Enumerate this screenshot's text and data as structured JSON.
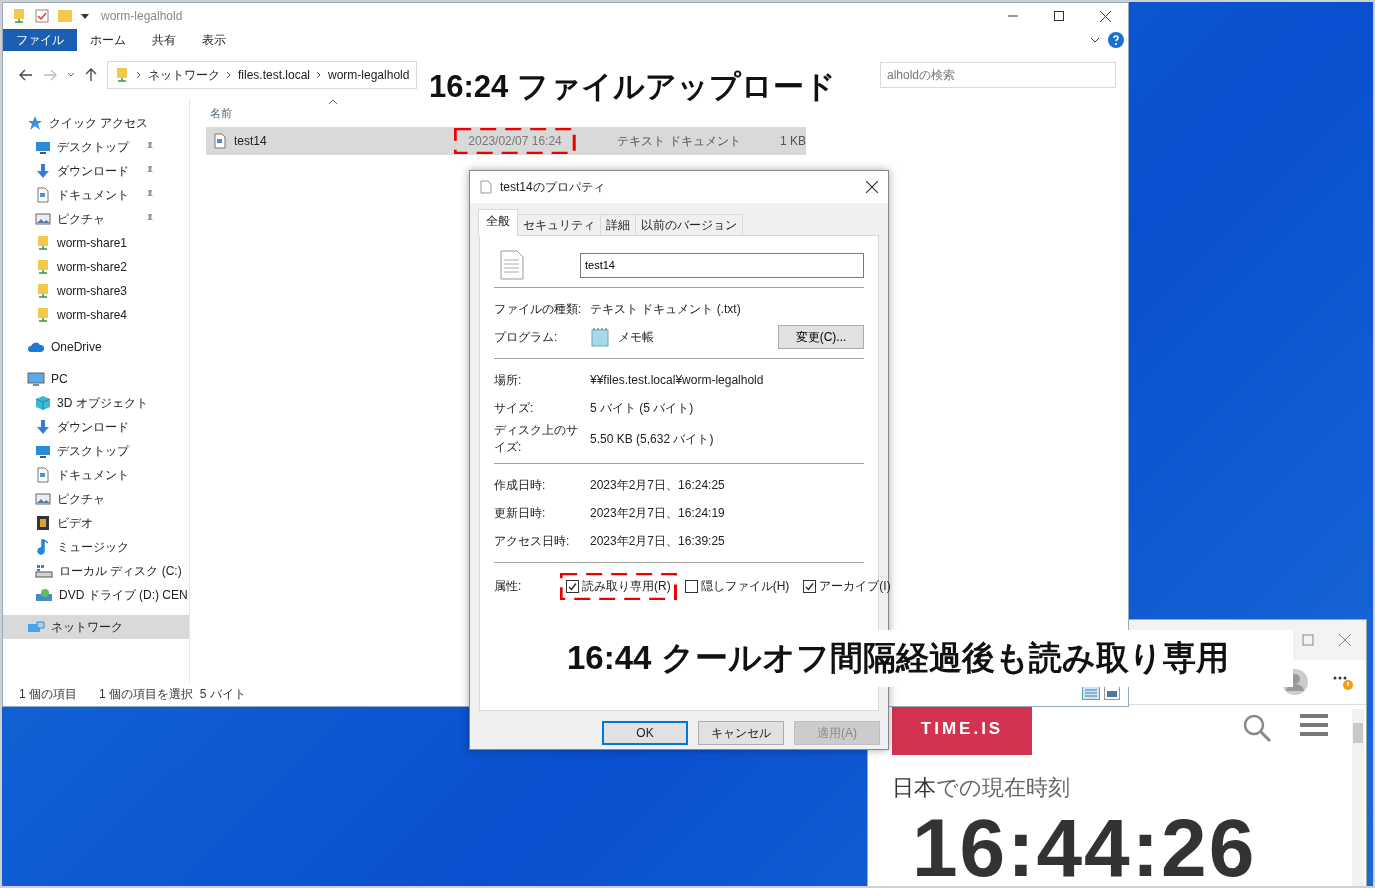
{
  "explorer": {
    "title": "worm-legalhold",
    "ribbon_tabs": [
      {
        "label": "ファイル",
        "selected": true
      },
      {
        "label": "ホーム",
        "selected": false
      },
      {
        "label": "共有",
        "selected": false
      },
      {
        "label": "表示",
        "selected": false
      }
    ],
    "breadcrumb": [
      "ネットワーク",
      "files.test.local",
      "worm-legalhold"
    ],
    "search": {
      "placeholder": "alholdの検索"
    },
    "columns": [
      "名前"
    ],
    "files": [
      {
        "name": "test14",
        "date": "2023/02/07 16:24",
        "type": "テキスト ドキュメント",
        "size": "1 KB",
        "selected": true
      }
    ],
    "sidebar": [
      {
        "label": "クイック アクセス",
        "kind": "star",
        "selected": false,
        "children": [
          {
            "label": "デスクトップ",
            "kind": "desktop",
            "pinned": true,
            "selected": false
          },
          {
            "label": "ダウンロード",
            "kind": "download",
            "pinned": true,
            "selected": false
          },
          {
            "label": "ドキュメント",
            "kind": "document",
            "pinned": true,
            "selected": false
          },
          {
            "label": "ピクチャ",
            "kind": "picture",
            "pinned": true,
            "selected": false
          },
          {
            "label": "worm-share1",
            "kind": "share",
            "pinned": false,
            "selected": false
          },
          {
            "label": "worm-share2",
            "kind": "share",
            "pinned": false,
            "selected": false
          },
          {
            "label": "worm-share3",
            "kind": "share",
            "pinned": false,
            "selected": false
          },
          {
            "label": "worm-share4",
            "kind": "share",
            "pinned": false,
            "selected": false
          }
        ]
      },
      {
        "label": "OneDrive",
        "kind": "cloud",
        "selected": false
      },
      {
        "label": "PC",
        "kind": "pc",
        "selected": false,
        "children": [
          {
            "label": "3D オブジェクト",
            "kind": "cube",
            "pinned": false,
            "selected": false
          },
          {
            "label": "ダウンロード",
            "kind": "download",
            "pinned": false,
            "selected": false
          },
          {
            "label": "デスクトップ",
            "kind": "desktop",
            "pinned": false,
            "selected": false
          },
          {
            "label": "ドキュメント",
            "kind": "document",
            "pinned": false,
            "selected": false
          },
          {
            "label": "ピクチャ",
            "kind": "picture",
            "pinned": false,
            "selected": false
          },
          {
            "label": "ビデオ",
            "kind": "video",
            "pinned": false,
            "selected": false
          },
          {
            "label": "ミュージック",
            "kind": "music",
            "pinned": false,
            "selected": false
          },
          {
            "label": "ローカル ディスク (C:)",
            "kind": "drive",
            "pinned": false,
            "selected": false
          },
          {
            "label": "DVD ドライブ (D:) CEN",
            "kind": "dvd",
            "pinned": false,
            "selected": false
          }
        ]
      },
      {
        "label": "ネットワーク",
        "kind": "network",
        "selected": true
      }
    ],
    "status": [
      "1 個の項目",
      "1 個の項目を選択  5 バイト"
    ]
  },
  "dialog": {
    "title": "test14のプロパティ",
    "tabs": [
      {
        "label": "全般",
        "selected": true
      },
      {
        "label": "セキュリティ",
        "selected": false
      },
      {
        "label": "詳細",
        "selected": false
      },
      {
        "label": "以前のバージョン",
        "selected": false
      }
    ],
    "filename": "test14",
    "groups": [
      [
        {
          "label": "ファイルの種類:",
          "value": "テキスト ドキュメント (.txt)"
        },
        {
          "label": "プログラム:",
          "value": "メモ帳",
          "button": "変更(C)..."
        }
      ],
      [
        {
          "label": "場所:",
          "value": "¥¥files.test.local¥worm-legalhold"
        },
        {
          "label": "サイズ:",
          "value": "5 バイト (5 バイト)"
        },
        {
          "label": "ディスク上のサイズ:",
          "value": "5.50 KB (5,632 バイト)"
        }
      ],
      [
        {
          "label": "作成日時:",
          "value": "2023年2月7日、16:24:25"
        },
        {
          "label": "更新日時:",
          "value": "2023年2月7日、16:24:19"
        },
        {
          "label": "アクセス日時:",
          "value": "2023年2月7日、16:39:25"
        }
      ]
    ],
    "attributes_label": "属性:",
    "attributes": [
      {
        "label": "読み取り専用(R)",
        "checked": true
      },
      {
        "label": "隠しファイル(H)",
        "checked": false
      },
      {
        "label": "アーカイブ(I)",
        "checked": true
      }
    ],
    "buttons": [
      {
        "label": "OK",
        "default": true,
        "disabled": false
      },
      {
        "label": "キャンセル",
        "default": false,
        "disabled": false
      },
      {
        "label": "適用(A)",
        "default": false,
        "disabled": true
      }
    ]
  },
  "browser": {
    "logo": "TIME.IS",
    "heading": "**日本**での現在時刻",
    "clock": "16:44:26"
  },
  "callouts": [
    "16:24 ファイルアップロード",
    "16:44 クールオフ間隔経過後も読み取り専用"
  ]
}
